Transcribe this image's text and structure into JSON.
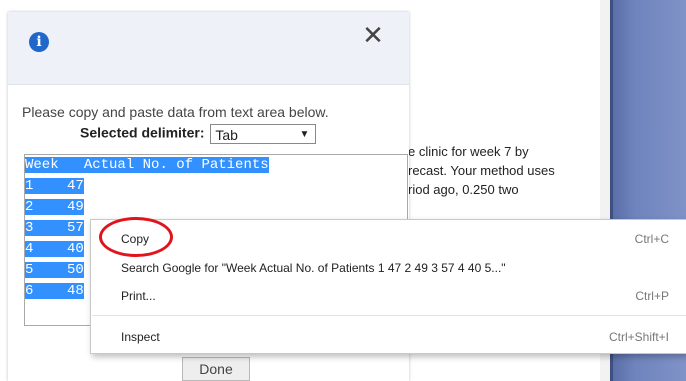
{
  "background": {
    "text_lines": [
      "e clinic for week 7 by",
      "recast. Your method uses",
      "riod ago, 0.250 two"
    ]
  },
  "dialog": {
    "info_icon": "info-icon",
    "close_icon": "close-icon",
    "close_glyph": "✕",
    "instructions": "Please copy and paste data from text area below.",
    "delimiter_label": "Selected delimiter:",
    "delimiter_value": "Tab",
    "textarea_lines": [
      [
        "Week",
        "   ",
        "Actual No. of Patients"
      ],
      [
        "1",
        "    ",
        "47"
      ],
      [
        "2",
        "    ",
        "49"
      ],
      [
        "3",
        "    ",
        "57"
      ],
      [
        "4",
        "    ",
        "40"
      ],
      [
        "5",
        "    ",
        "50"
      ],
      [
        "6",
        "    ",
        "48"
      ]
    ],
    "done_label": "Done"
  },
  "context_menu": {
    "items": [
      {
        "label": "Copy",
        "shortcut": "Ctrl+C"
      },
      {
        "label": "Search Google for \"Week Actual No. of Patients 1 47 2 49 3 57 4 40 5...\"",
        "shortcut": ""
      },
      {
        "label": "Print...",
        "shortcut": "Ctrl+P"
      },
      {
        "label": "Inspect",
        "shortcut": "Ctrl+Shift+I"
      }
    ]
  },
  "colors": {
    "selection": "#3390ff",
    "highlight_circle": "#e0141c",
    "info_icon": "#1f68c9"
  }
}
